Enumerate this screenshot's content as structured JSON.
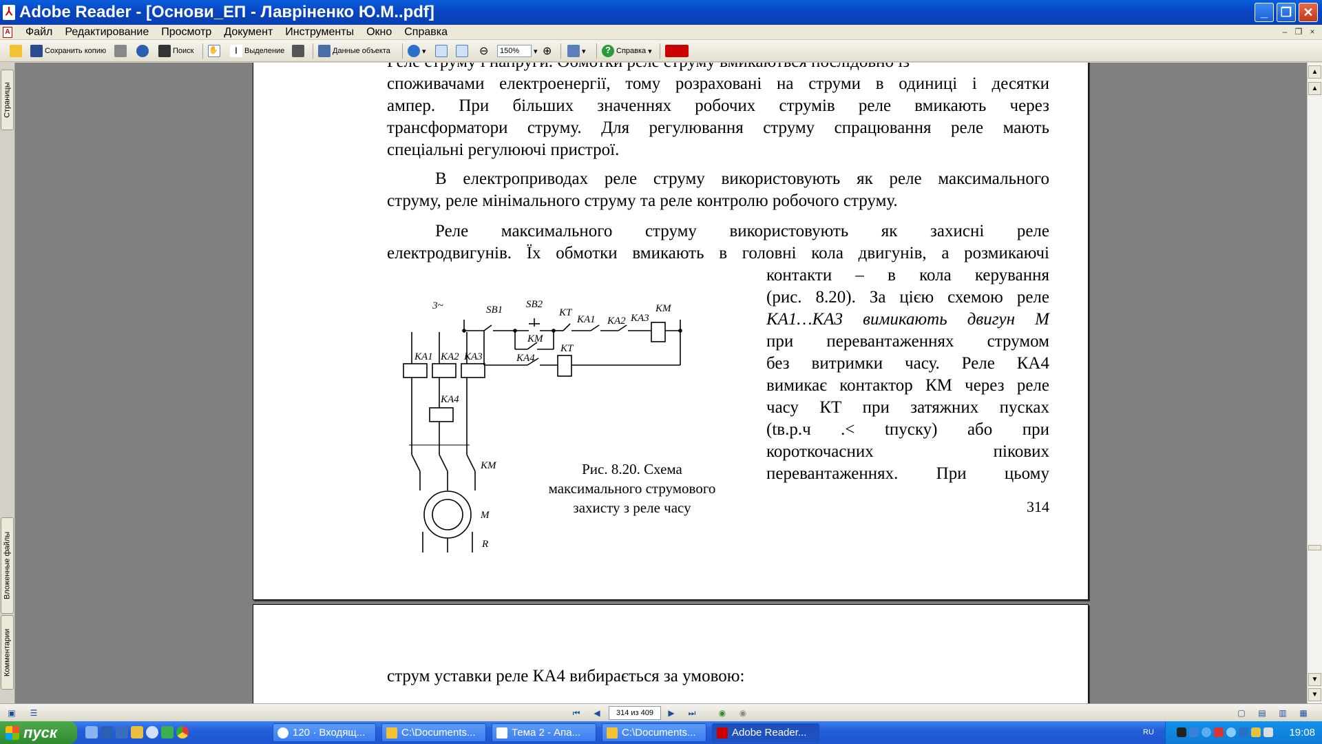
{
  "window": {
    "title": "Adobe Reader - [Основи_ЕП - Лавріненко Ю.М..pdf]"
  },
  "menu": [
    "Файл",
    "Редактирование",
    "Просмотр",
    "Документ",
    "Инструменты",
    "Окно",
    "Справка"
  ],
  "toolbar": {
    "save_copy": "Сохранить копию",
    "search": "Поиск",
    "select": "Выделение",
    "object_data": "Данные объекта",
    "zoom": "150%",
    "help": "Справка"
  },
  "nav_tabs": {
    "pages": "Страницы",
    "attachments": "Вложенные файлы",
    "comments": "Комментарии"
  },
  "page314": {
    "line0": "Реле струму і напруги. Обмотки реле струму вмикаються послідовно із",
    "para1": [
      "споживачами електроенергії, тому розраховані на струми в одиниці і десятки",
      "ампер. При більших значеннях робочих струмів реле вмикають через",
      "трансформатори струму. Для регулювання струму спрацювання реле мають",
      "спеціальні регулюючі пристрої."
    ],
    "para2": [
      "В електроприводах реле струму використовують як реле максимального",
      "струму, реле мінімального струму та реле  контролю робочого струму."
    ],
    "para3": [
      "Реле максимального струму використовують як захисні реле",
      "електродвигунів. Їх обмотки вмикають в головні кола двигунів, а розмикаючі"
    ],
    "side": [
      "контакти – в кола керування",
      "(рис. 8.20). За цією схемою реле",
      "КА1…КА3 вимикають двигун М",
      "при перевантаженнях струмом",
      "без витримки часу. Реле КА4",
      "вимикає контактор КМ через реле",
      "часу КТ при затяжних пусках",
      "(tв.р.ч .< tпуску) або при",
      "короткочасних пікових",
      "перевантаженнях. При цьому"
    ],
    "caption": [
      "Рис. 8.20. Схема",
      "максимального струмового",
      "захисту з реле часу"
    ],
    "page_number": "314"
  },
  "diagram_labels": {
    "phase": "3~",
    "sb1": "SB1",
    "sb2": "SB2",
    "kt_top": "KT",
    "ka1_top": "KA1",
    "ka2_top": "KA2",
    "ka3_top": "KA3",
    "km_top": "KM",
    "km_contact": "KM",
    "ka4_contact": "KA4",
    "kt_coil": "KT",
    "ka1": "KA1",
    "ka2": "KA2",
    "ka3": "KA3",
    "ka4": "KA4",
    "km_main": "KM",
    "motor": "M",
    "rheostat": "R"
  },
  "page315": {
    "line": "струм уставки реле КА4 вибирається за умовою:"
  },
  "statusbar": {
    "page_field": "314 из 409"
  },
  "taskbar": {
    "start": "пуск",
    "tasks": [
      "120 · Входящ...",
      "C:\\Documents...",
      "Тема 2 - Апа...",
      "C:\\Documents...",
      "Adobe Reader..."
    ],
    "lang": "RU",
    "clock": "19:08"
  }
}
